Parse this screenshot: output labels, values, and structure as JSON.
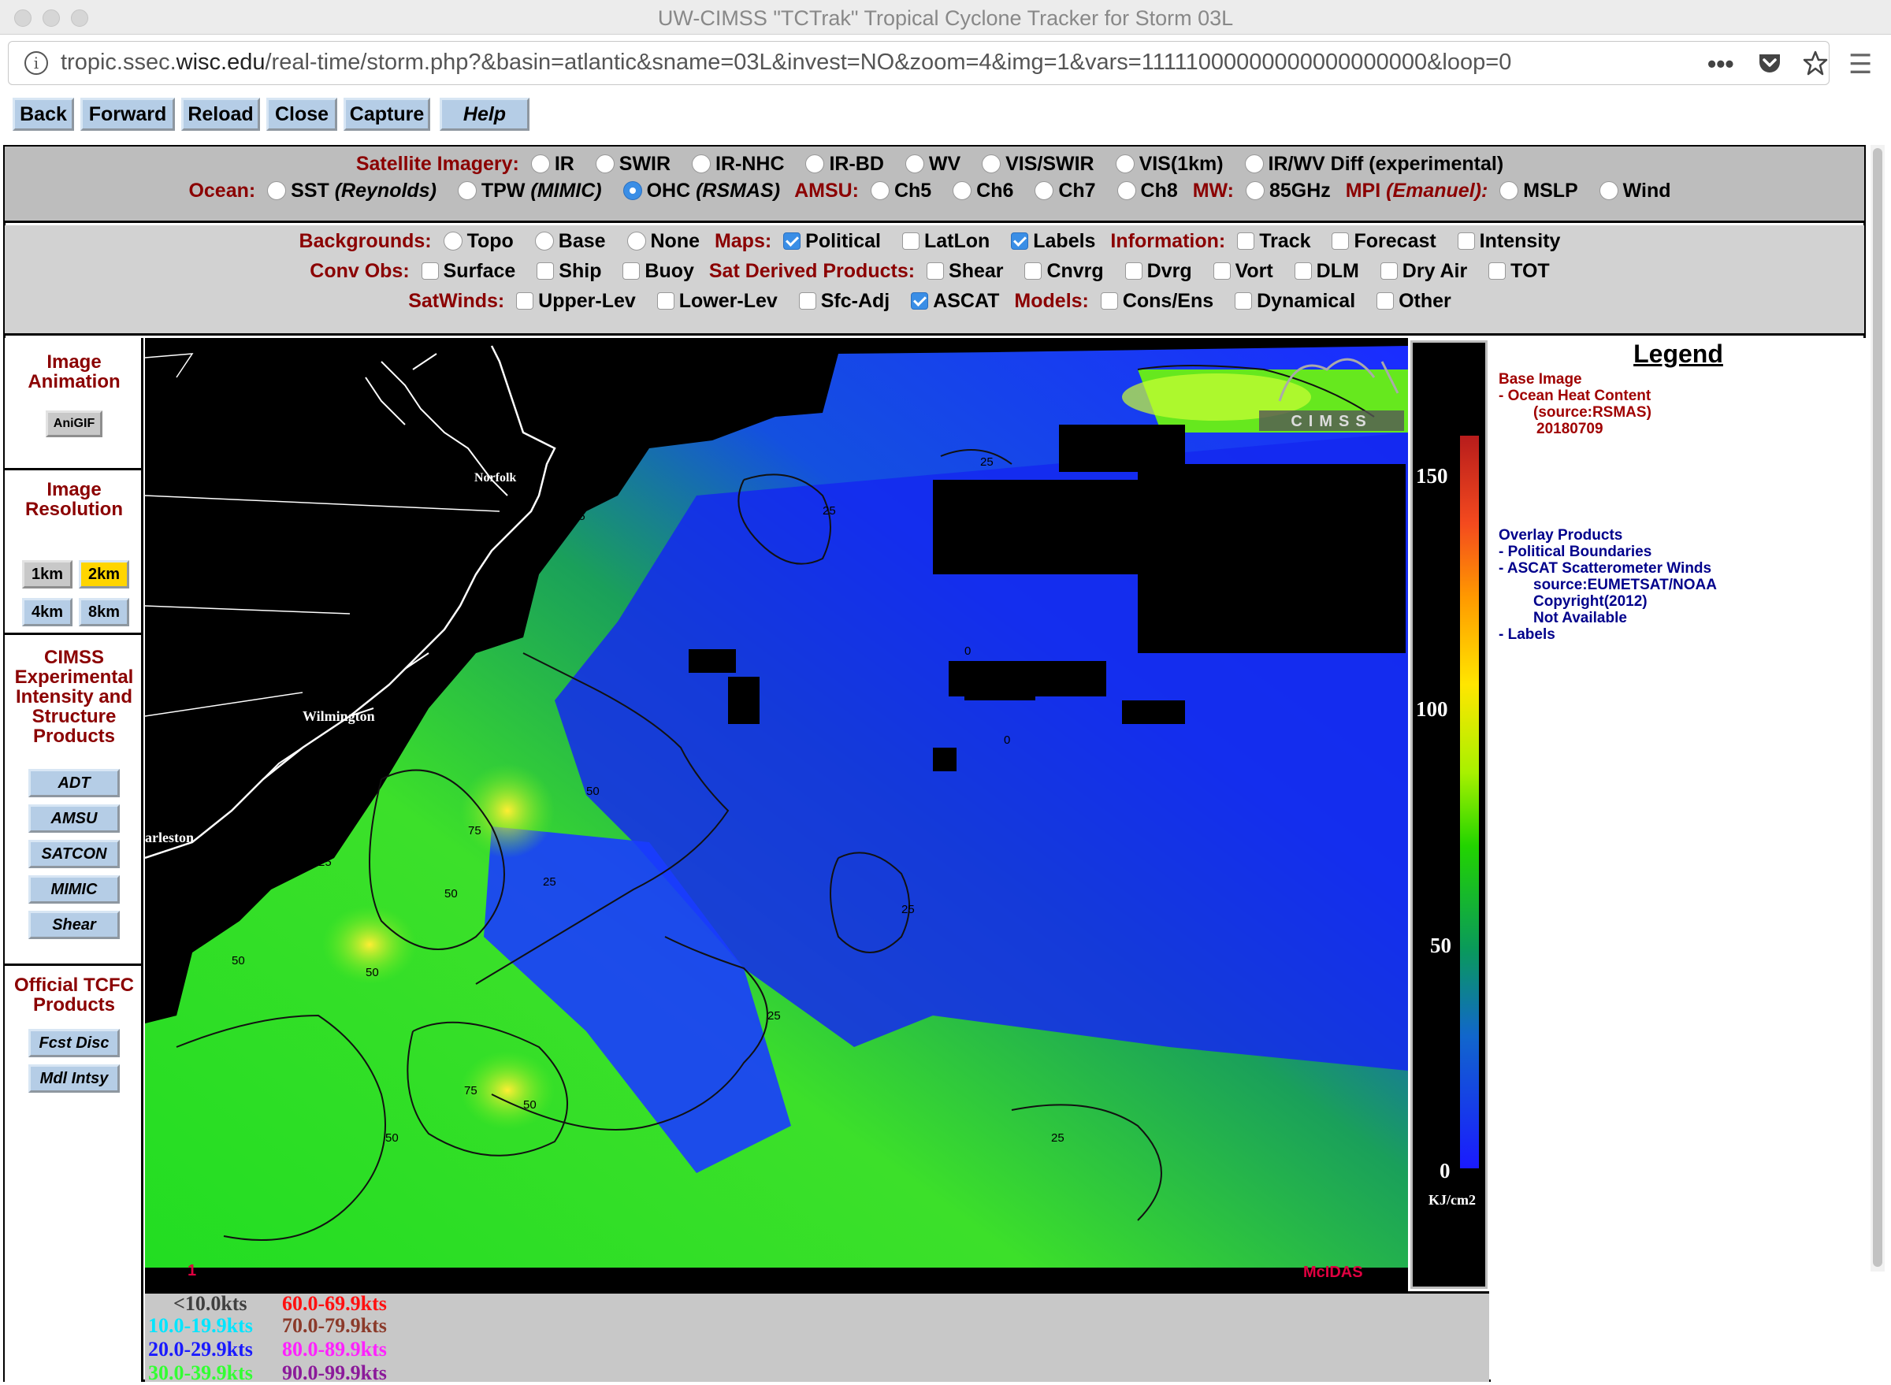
{
  "window": {
    "title": "UW-CIMSS \"TCTrak\" Tropical Cyclone Tracker for Storm 03L"
  },
  "url": {
    "prefix": "tropic.ssec.",
    "domain": "wisc.edu",
    "path": "/real-time/storm.php?&basin=atlantic&sname=03L&invest=NO&zoom=4&img=1&vars=11111000000000000000000&loop=0"
  },
  "nav": {
    "back": "Back",
    "forward": "Forward",
    "reload": "Reload",
    "close": "Close",
    "capture": "Capture",
    "help": "Help"
  },
  "imagery": {
    "satellite_label": "Satellite Imagery:",
    "satellite_options": [
      "IR",
      "SWIR",
      "IR-NHC",
      "IR-BD",
      "WV",
      "VIS/SWIR",
      "VIS(1km)",
      "IR/WV Diff (experimental)"
    ],
    "ocean_label": "Ocean:",
    "ocean_options": [
      {
        "name": "SST",
        "source": "(Reynolds)"
      },
      {
        "name": "TPW",
        "source": "(MIMIC)"
      },
      {
        "name": "OHC",
        "source": "(RSMAS)"
      }
    ],
    "ocean_selected": "OHC",
    "amsu_label": "AMSU:",
    "amsu_options": [
      "Ch5",
      "Ch6",
      "Ch7",
      "Ch8"
    ],
    "mw_label": "MW:",
    "mw_options": [
      "85GHz"
    ],
    "mpi_label": "MPI",
    "mpi_source": "(Emanuel):",
    "mpi_options": [
      "MSLP",
      "Wind"
    ]
  },
  "overlays": {
    "backgrounds_label": "Backgrounds:",
    "backgrounds": [
      "Topo",
      "Base",
      "None"
    ],
    "maps_label": "Maps:",
    "maps": [
      {
        "name": "Political",
        "checked": true
      },
      {
        "name": "LatLon",
        "checked": false
      },
      {
        "name": "Labels",
        "checked": true
      }
    ],
    "information_label": "Information:",
    "information": [
      "Track",
      "Forecast",
      "Intensity"
    ],
    "convobs_label": "Conv Obs:",
    "convobs": [
      "Surface",
      "Ship",
      "Buoy"
    ],
    "satderived_label": "Sat Derived Products:",
    "satderived": [
      "Shear",
      "Cnvrg",
      "Dvrg",
      "Vort",
      "DLM",
      "Dry Air",
      "TOT"
    ],
    "satwinds_label": "SatWinds:",
    "satwinds": [
      {
        "name": "Upper-Lev",
        "checked": false
      },
      {
        "name": "Lower-Lev",
        "checked": false
      },
      {
        "name": "Sfc-Adj",
        "checked": false
      },
      {
        "name": "ASCAT",
        "checked": true
      }
    ],
    "models_label": "Models:",
    "models": [
      "Cons/Ens",
      "Dynamical",
      "Other"
    ]
  },
  "sidebar": {
    "animation_title": "Image Animation",
    "anigif": "AniGIF",
    "resolution_title": "Image Resolution",
    "res_1km": "1km",
    "res_2km": "2km",
    "res_4km": "4km",
    "res_8km": "8km",
    "res_selected": "2km",
    "cimss_title": "CIMSS Experimental Intensity and Structure Products",
    "adt": "ADT",
    "amsu": "AMSU",
    "satcon": "SATCON",
    "mimic": "MIMIC",
    "shear": "Shear",
    "tcfc_title": "Official TCFC Products",
    "fcst_disc": "Fcst Disc",
    "mdl_intsy": "Mdl Intsy"
  },
  "map": {
    "city_norfolk": "Norfolk",
    "city_wilmington": "Wilmington",
    "city_charleston": "arleston",
    "frame_number": "1",
    "mcidas": "McIDAS",
    "logo": "CIMSS",
    "contours": [
      "25",
      "50",
      "75",
      "0"
    ]
  },
  "colorbar": {
    "labels": [
      "150",
      "100",
      "50",
      "0"
    ],
    "values": [
      150,
      100,
      50,
      0
    ],
    "unit": "KJ/cm2"
  },
  "legend": {
    "title": "Legend",
    "base_image": "Base Image",
    "ohc": "-  Ocean Heat Content",
    "ohc_source": "(source:RSMAS)",
    "ohc_date": "20180709",
    "overlay_products": "Overlay Products",
    "political": "-  Political Boundaries",
    "ascat": "-  ASCAT Scatterometer Winds",
    "ascat_source": "source:EUMETSAT/NOAA",
    "ascat_copyright": "Copyright(2012)",
    "ascat_na": "Not Available",
    "labels": "-  Labels"
  },
  "wind_legend": {
    "c1": "<10.0kts",
    "c2": "10.0-19.9kts",
    "c3": "20.0-29.9kts",
    "c4": "30.0-39.9kts",
    "c5": "60.0-69.9kts",
    "c6": "70.0-79.9kts",
    "c7": "80.0-89.9kts",
    "c8": "90.0-99.9kts",
    "colors": [
      "#404040",
      "#00e5ff",
      "#1a1aff",
      "#33ff33",
      "#ff1010",
      "#8b3a2a",
      "#ff22ff",
      "#8b1a9a"
    ]
  },
  "colors": {
    "label_red": "#8b0000",
    "button_blue": "#b5cde6",
    "selected_yellow": "#ffd500",
    "radio_blue": "#3a8ee6"
  }
}
